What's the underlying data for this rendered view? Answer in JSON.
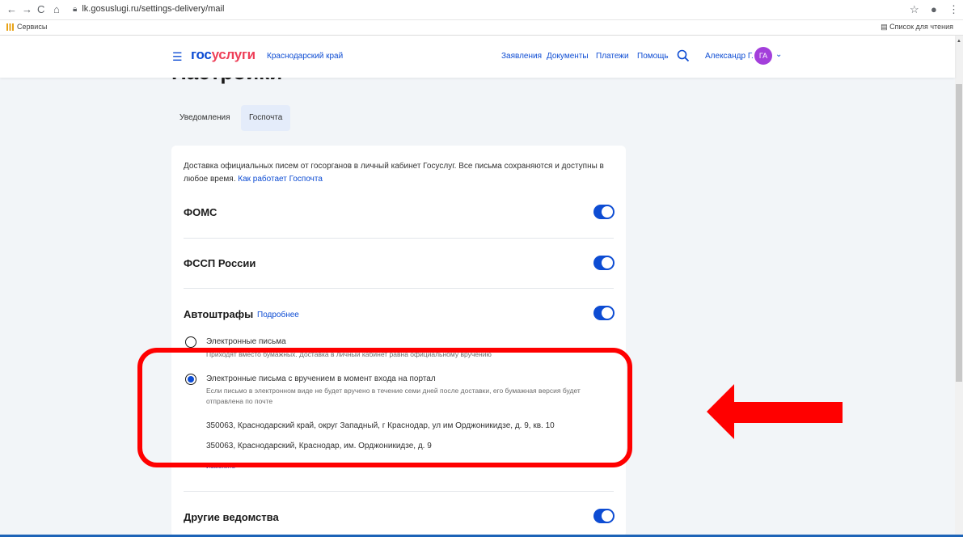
{
  "browser": {
    "url": "lk.gosuslugi.ru/settings-delivery/mail",
    "apps_label": "Сервисы",
    "reading_list": "Список для чтения"
  },
  "header": {
    "logo_part1": "гос",
    "logo_part2": "услуги",
    "region": "Краснодарский край",
    "nav": [
      "Заявления",
      "Документы",
      "Платежи",
      "Помощь"
    ],
    "user_name": "Александр Г.",
    "avatar_initials": "ГА"
  },
  "page": {
    "title": "Настройки",
    "tabs": [
      {
        "label": "Уведомления",
        "active": false
      },
      {
        "label": "Госпочта",
        "active": true
      }
    ]
  },
  "card": {
    "intro_text": "Доставка официальных писем от госорганов в личный кабинет Госуслуг. Все письма сохраняются и доступны в любое время.",
    "intro_link": "Как работает Госпочта",
    "rows": [
      {
        "title": "ФОМС",
        "enabled": true
      },
      {
        "title": "ФССП России",
        "enabled": true
      },
      {
        "title": "Автоштрафы",
        "more": "Подробнее",
        "enabled": true
      },
      {
        "title": "Другие ведомства",
        "enabled": true
      }
    ],
    "options": [
      {
        "label": "Электронные письма",
        "desc": "Приходят вместо бумажных. Доставка в личный кабинет равна официальному вручению",
        "checked": false
      },
      {
        "label": "Электронные письма с вручением в момент входа на портал",
        "desc": "Если письмо в электронном виде не будет вручено в течение семи дней после доставки, его бумажная версия будет отправлена по почте",
        "checked": true
      }
    ],
    "addresses": [
      "350063, Краснодарский край, округ Западный, г Краснодар, ул им Орджоникидзе, д. 9, кв. 10",
      "350063, Краснодарский, Краснодар, им. Орджоникидзе, д. 9"
    ],
    "change_link": "Изменить"
  },
  "colors": {
    "brand_blue": "#0d4cd3",
    "brand_red": "#ee3f58",
    "annotation_red": "#ff0000",
    "avatar": "#a33fdb"
  }
}
